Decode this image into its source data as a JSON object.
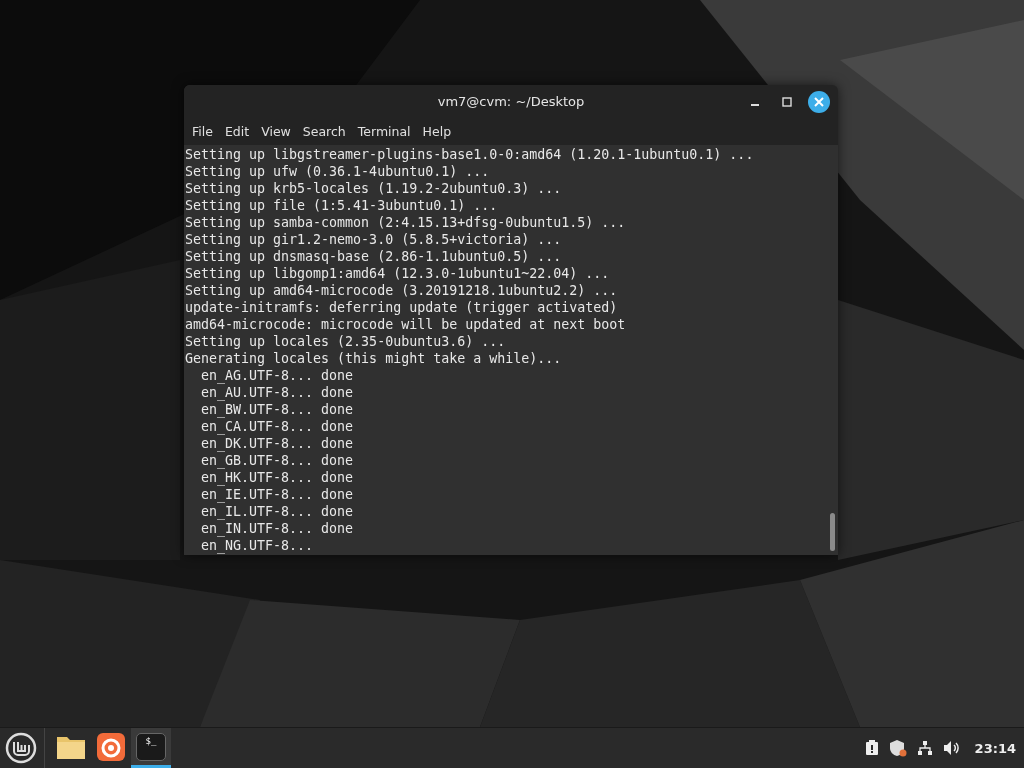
{
  "window": {
    "title": "vm7@cvm: ~/Desktop"
  },
  "menu": [
    "File",
    "Edit",
    "View",
    "Search",
    "Terminal",
    "Help"
  ],
  "terminal_lines": [
    "Setting up libgstreamer-plugins-base1.0-0:amd64 (1.20.1-1ubuntu0.1) ...",
    "Setting up ufw (0.36.1-4ubuntu0.1) ...",
    "Setting up krb5-locales (1.19.2-2ubuntu0.3) ...",
    "Setting up file (1:5.41-3ubuntu0.1) ...",
    "Setting up samba-common (2:4.15.13+dfsg-0ubuntu1.5) ...",
    "Setting up gir1.2-nemo-3.0 (5.8.5+victoria) ...",
    "Setting up dnsmasq-base (2.86-1.1ubuntu0.5) ...",
    "Setting up libgomp1:amd64 (12.3.0-1ubuntu1~22.04) ...",
    "Setting up amd64-microcode (3.20191218.1ubuntu2.2) ...",
    "update-initramfs: deferring update (trigger activated)",
    "amd64-microcode: microcode will be updated at next boot",
    "Setting up locales (2.35-0ubuntu3.6) ...",
    "Generating locales (this might take a while)...",
    "  en_AG.UTF-8... done",
    "  en_AU.UTF-8... done",
    "  en_BW.UTF-8... done",
    "  en_CA.UTF-8... done",
    "  en_DK.UTF-8... done",
    "  en_GB.UTF-8... done",
    "  en_HK.UTF-8... done",
    "  en_IE.UTF-8... done",
    "  en_IL.UTF-8... done",
    "  en_IN.UTF-8... done",
    "  en_NG.UTF-8..."
  ],
  "taskbar": {
    "apps": [
      {
        "kind": "folder",
        "selected": false
      },
      {
        "kind": "browser",
        "selected": false
      },
      {
        "kind": "terminal",
        "selected": true,
        "label": "$_"
      }
    ],
    "clock": "23:14"
  }
}
